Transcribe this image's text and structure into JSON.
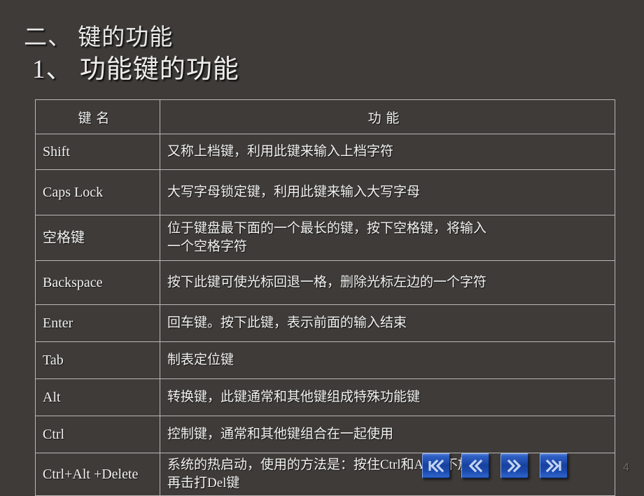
{
  "slide": {
    "title_line1": "二、 键的功能",
    "title_line2": "1、 功能键的功能",
    "page_number": "4",
    "background_color": "#3e3b38",
    "accent_color": "#1c4bb0",
    "text_color": "#f2f2f2"
  },
  "table": {
    "headers": [
      "键     名",
      "功        能"
    ],
    "rows": [
      {
        "key": "Shift",
        "func": "又称上档键，利用此键来输入上档字符",
        "func2": ""
      },
      {
        "key": "Caps Lock",
        "func": "大写字母锁定键，利用此键来输入大写字母",
        "func2": ""
      },
      {
        "key": "空格键",
        "func": "位于键盘最下面的一个最长的键，按下空格键，将输入",
        "func2": "一个空格字符"
      },
      {
        "key": "Backspace",
        "func": "按下此键可使光标回退一格，删除光标左边的一个字符",
        "func2": ""
      },
      {
        "key": "Enter",
        "func": "回车键。按下此键，表示前面的输入结束",
        "func2": ""
      },
      {
        "key": "Tab",
        "func": "制表定位键",
        "func2": ""
      },
      {
        "key": "Alt",
        "func": "转换键，此键通常和其他键组成特殊功能键",
        "func2": ""
      },
      {
        "key": "Ctrl",
        "func": "控制键，通常和其他键组合在一起使用",
        "func2": ""
      },
      {
        "key": "Ctrl+Alt\n+Delete",
        "key_line1": "Ctrl+Alt",
        "key_line2": "+Delete",
        "func": "系统的热启动，使用的方法是：按住Ctrl和Alt键不放，",
        "func2": "再击打Del键"
      }
    ]
  },
  "nav": {
    "buttons": [
      {
        "name": "first-slide-button",
        "icon": "first-icon",
        "label": "|«"
      },
      {
        "name": "previous-slide-button",
        "icon": "previous-icon",
        "label": "«"
      },
      {
        "name": "next-slide-button",
        "icon": "next-icon",
        "label": "»"
      },
      {
        "name": "last-slide-button",
        "icon": "last-icon",
        "label": "»|"
      }
    ]
  }
}
